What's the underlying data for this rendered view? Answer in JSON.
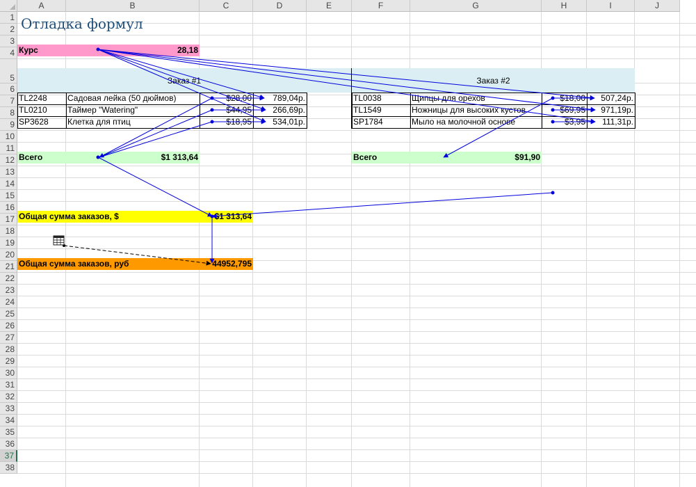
{
  "columns": [
    "A",
    "B",
    "C",
    "D",
    "E",
    "F",
    "G",
    "H",
    "I",
    "J"
  ],
  "rows": [
    "1",
    "2",
    "3",
    "4",
    "5",
    "6",
    "7",
    "8",
    "9",
    "10",
    "11",
    "12",
    "13",
    "14",
    "15",
    "16",
    "17",
    "18",
    "19",
    "20",
    "21",
    "22",
    "23",
    "24",
    "25",
    "26",
    "27",
    "28",
    "29",
    "30",
    "31",
    "32",
    "33",
    "34",
    "35",
    "36",
    "37",
    "38"
  ],
  "active_row": "37",
  "sheet": {
    "title": "Отладка формул",
    "rate_label": "Курс",
    "rate_value": "28,18",
    "order1": {
      "header": "Заказ #1",
      "items": [
        {
          "code": "TL2248",
          "name": "Садовая лейка (50 дюймов)",
          "price": "$28,00",
          "rub": "789,04р."
        },
        {
          "code": "TL0210",
          "name": "Таймер \"Watering\"",
          "price": "$44,95",
          "rub": "266,69р."
        },
        {
          "code": "SP3628",
          "name": "Клетка для птиц",
          "price": "$18,95",
          "rub": "534,01р."
        }
      ],
      "total_label": "Всего",
      "total_value": "$1 313,64"
    },
    "order2": {
      "header": "Заказ #2",
      "items": [
        {
          "code": "TL0038",
          "name": "Щипцы для орехов",
          "price": "$18,00",
          "rub": "507,24р."
        },
        {
          "code": "TL1549",
          "name": "Ножницы для высоких кустов",
          "price": "$69,95",
          "rub": "971,19р."
        },
        {
          "code": "SP1784",
          "name": "Мыло на молочной основе",
          "price": "$3,95",
          "rub": "111,31р."
        }
      ],
      "total_label": "Всего",
      "total_value": "$91,90"
    },
    "sum_usd_label": "Общая сумма заказов, $",
    "sum_usd_value": "$1 313,64",
    "sum_rub_label": "Общая сумма заказов, руб",
    "sum_rub_value": "44952,795"
  },
  "colors": {
    "title": "#1f4e79",
    "rate_fill": "#ff99cc",
    "header_fill": "#daeef3",
    "total_fill": "#ccffcc",
    "sum_usd_fill": "#ffff00",
    "sum_rub_fill": "#ff9900",
    "tracer_arrow": "#0000dd",
    "external_ref": "#000000",
    "active_header": "#217346"
  },
  "icons": {
    "worksheet_ref": "sheet-grid-icon"
  }
}
